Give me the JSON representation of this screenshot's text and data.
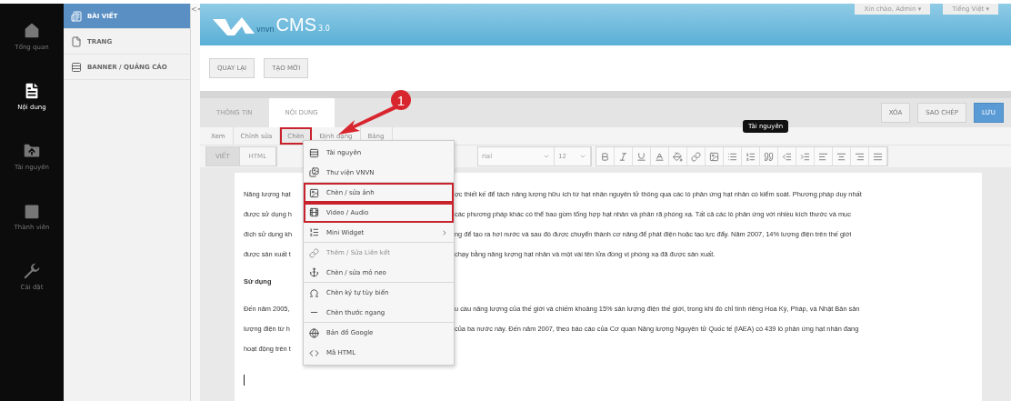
{
  "nav": [
    {
      "label": "Tổng quan",
      "selected": false
    },
    {
      "label": "Nội dung",
      "selected": true
    },
    {
      "label": "Tài nguyên",
      "selected": false
    },
    {
      "label": "Thành viên",
      "selected": false
    },
    {
      "label": "Cài đặt",
      "selected": false
    }
  ],
  "subnav": [
    {
      "label": "BÀI VIẾT",
      "selected": true
    },
    {
      "label": "TRANG",
      "selected": false
    },
    {
      "label": "BANNER / QUẢNG CÁO",
      "selected": false
    }
  ],
  "collapse": "<<",
  "header": {
    "logo_mark": "vnvn",
    "logo_text": "CMS",
    "logo_version": "3.0",
    "user_menu": "Xin chào, Admin ▾",
    "language_menu": "Tiếng Việt ▾"
  },
  "actions": [
    "QUAY LẠI",
    "TẠO MỚI"
  ],
  "tabs": [
    {
      "label": "THÔNG TIN",
      "selected": false
    },
    {
      "label": "NỘI DUNG",
      "selected": true
    }
  ],
  "tab_actions": [
    {
      "label": "XÓA",
      "kind": "plain"
    },
    {
      "label": "SAO CHÉP",
      "kind": "plain"
    },
    {
      "label": "LƯU",
      "kind": "primary"
    }
  ],
  "menubar": [
    {
      "label": "Xem",
      "selected": false
    },
    {
      "label": "Chỉnh sửa",
      "selected": false
    },
    {
      "label": "Chèn",
      "selected": true
    },
    {
      "label": "Định dạng",
      "selected": false
    },
    {
      "label": "Bảng",
      "selected": false
    }
  ],
  "modes": [
    {
      "label": "VIẾT",
      "selected": true
    },
    {
      "label": "HTML",
      "selected": false
    }
  ],
  "font": "rial",
  "size": "12",
  "tooltip": "Tài nguyên",
  "insert_menu": [
    {
      "label": "Tài nguyên",
      "highlighted": false,
      "disabled": false,
      "submenu": false,
      "divider_after": false
    },
    {
      "label": "Thư viện VNVN",
      "highlighted": false,
      "disabled": false,
      "submenu": false,
      "divider_after": true
    },
    {
      "label": "Chèn / sửa ảnh",
      "highlighted": true,
      "disabled": false,
      "submenu": false,
      "divider_after": false
    },
    {
      "label": "Video / Audio",
      "highlighted": true,
      "disabled": false,
      "submenu": false,
      "divider_after": true
    },
    {
      "label": "Mini Widget",
      "highlighted": false,
      "disabled": false,
      "submenu": true,
      "divider_after": true
    },
    {
      "label": "Thêm / Sửa Liên kết",
      "highlighted": false,
      "disabled": true,
      "submenu": false,
      "divider_after": false
    },
    {
      "label": "Chèn / sửa mỏ neo",
      "highlighted": false,
      "disabled": false,
      "submenu": false,
      "divider_after": true
    },
    {
      "label": "Chèn ký tự tùy biến",
      "highlighted": false,
      "disabled": false,
      "submenu": false,
      "divider_after": false
    },
    {
      "label": "Chèn thước ngang",
      "highlighted": false,
      "disabled": false,
      "submenu": false,
      "divider_after": true
    },
    {
      "label": "Bản đồ Google",
      "highlighted": false,
      "disabled": false,
      "submenu": false,
      "divider_after": false
    },
    {
      "label": "Mã HTML",
      "highlighted": false,
      "disabled": false,
      "submenu": false,
      "divider_after": false
    }
  ],
  "annotation": {
    "badge": "1"
  },
  "content": [
    {
      "kind": "line",
      "left": "Năng lượng hạt",
      "right": "ợc thiết kế để tách năng lượng hữu ích từ hạt nhân nguyên tử thông qua các lò phản ứng hạt nhân có kiểm soát. Phương pháp duy nhất"
    },
    {
      "kind": "line",
      "left": "được sử dụng h",
      "right": "các phương pháp khác có thể bao gồm tổng hợp hạt nhân và phân rã phóng xạ. Tất cả các lò phản ứng với nhiều kích thước và mục"
    },
    {
      "kind": "line",
      "left": "đích sử dụng kh",
      "right": "ng để tạo ra hơi nước và sau đó được chuyển thành cơ năng để phát điện hoặc tạo lực đẩy. Năm 2007, 14% lượng điện trên thế giới"
    },
    {
      "kind": "line",
      "left": "được sản xuất t",
      "right": "chạy bằng năng lượng hạt nhân và một vài tên lửa đồng vị phóng xạ đã được sản xuất."
    },
    {
      "kind": "heading",
      "left": "Sử dụng"
    },
    {
      "kind": "line",
      "left": "Đến năm 2005,",
      "right": "u cầu năng lượng của thế giới và chiếm khoảng 15% sản lượng điện thế giới, trong khi đó chỉ tính riêng Hoa Kỳ, Pháp, và Nhật Bản sản"
    },
    {
      "kind": "line",
      "left": "lượng điện từ h",
      "right": "của ba nước này. Đến năm 2007, theo báo cáo của Cơ quan Năng lượng Nguyên tử Quốc tế (IAEA) có 439 lò phản ứng hạt nhân đang"
    },
    {
      "kind": "line",
      "left": "hoạt động trên t"
    }
  ]
}
